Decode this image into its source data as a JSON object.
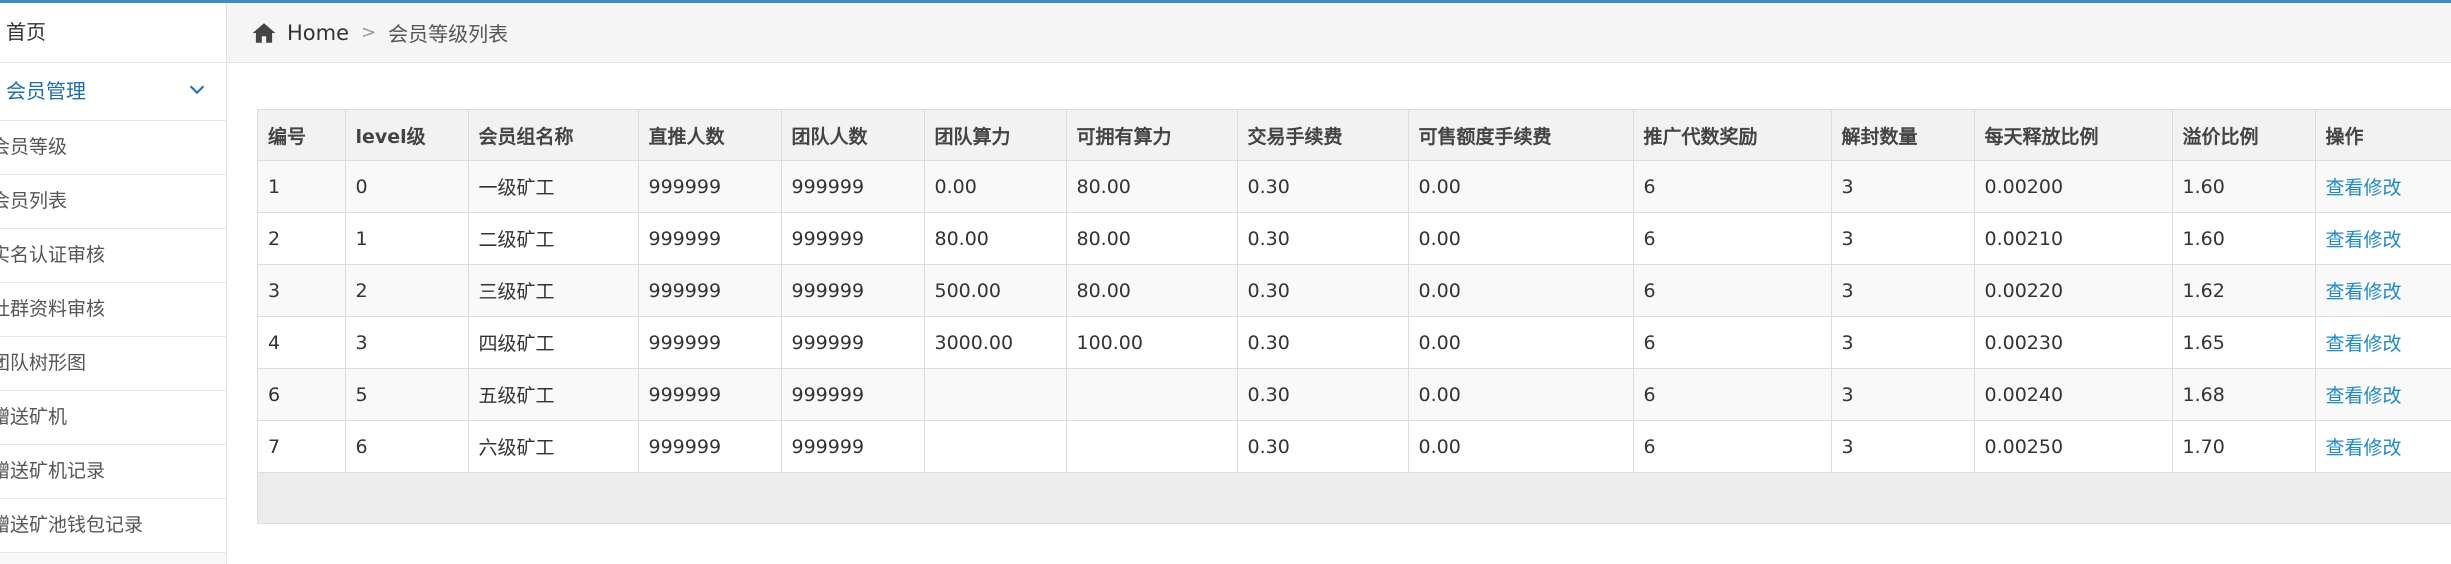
{
  "sidebar": {
    "home": "首页",
    "group": "会员管理",
    "items": [
      "会员等级",
      "会员列表",
      "实名认证审核",
      "社群资料审核",
      "团队树形图",
      "赠送矿机",
      "赠送矿机记录",
      "赠送矿池钱包记录"
    ]
  },
  "breadcrumb": {
    "home": "Home",
    "separator": ">",
    "current": "会员等级列表"
  },
  "table": {
    "headers": [
      "编号",
      "level级",
      "会员组名称",
      "直推人数",
      "团队人数",
      "团队算力",
      "可拥有算力",
      "交易手续费",
      "可售额度手续费",
      "推广代数奖励",
      "解封数量",
      "每天释放比例",
      "溢价比例",
      "操作"
    ],
    "rows": [
      [
        "1",
        "0",
        "一级矿工",
        "999999",
        "999999",
        "0.00",
        "80.00",
        "0.30",
        "0.00",
        "6",
        "3",
        "0.00200",
        "1.60",
        "查看修改"
      ],
      [
        "2",
        "1",
        "二级矿工",
        "999999",
        "999999",
        "80.00",
        "80.00",
        "0.30",
        "0.00",
        "6",
        "3",
        "0.00210",
        "1.60",
        "查看修改"
      ],
      [
        "3",
        "2",
        "三级矿工",
        "999999",
        "999999",
        "500.00",
        "80.00",
        "0.30",
        "0.00",
        "6",
        "3",
        "0.00220",
        "1.62",
        "查看修改"
      ],
      [
        "4",
        "3",
        "四级矿工",
        "999999",
        "999999",
        "3000.00",
        "100.00",
        "0.30",
        "0.00",
        "6",
        "3",
        "0.00230",
        "1.65",
        "查看修改"
      ],
      [
        "6",
        "5",
        "五级矿工",
        "999999",
        "999999",
        "",
        "",
        "0.30",
        "0.00",
        "6",
        "3",
        "0.00240",
        "1.68",
        "查看修改"
      ],
      [
        "7",
        "6",
        "六级矿工",
        "999999",
        "999999",
        "",
        "",
        "0.30",
        "0.00",
        "6",
        "3",
        "0.00250",
        "1.70",
        "查看修改"
      ]
    ]
  },
  "colors": {
    "accent": "#3c8dbc",
    "link": "#1e88c9",
    "active_menu": "#1e6db4"
  },
  "icons": {
    "breadcrumb_home": "home-icon",
    "group_toggle": "chevron-down-icon"
  }
}
